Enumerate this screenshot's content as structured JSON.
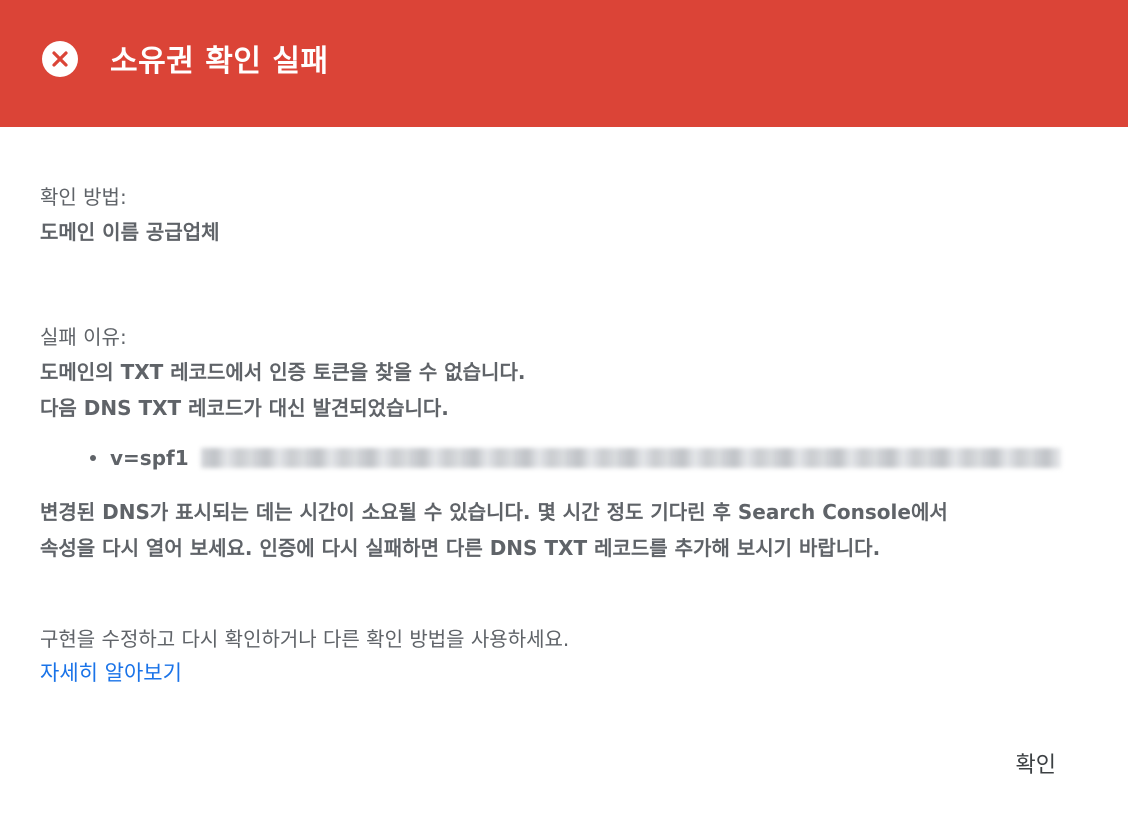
{
  "header": {
    "title": "소유권 확인 실패",
    "icon": "error-circle-icon",
    "background_color": "#db4437"
  },
  "verification_method": {
    "label": "확인 방법:",
    "value": "도메인 이름 공급업체"
  },
  "failure_reason": {
    "label": "실패 이유:",
    "line1": "도메인의 TXT 레코드에서 인증 토큰을 찾을 수 없습니다.",
    "line2": "다음 DNS TXT 레코드가 대신 발견되었습니다.",
    "records": [
      {
        "value": "v=spf1"
      }
    ]
  },
  "notice": {
    "line1": "변경된 DNS가 표시되는 데는 시간이 소요될 수 있습니다. 몇 시간 정도 기다린 후 Search Console에서",
    "line2": "속성을 다시 열어 보세요. 인증에 다시 실패하면 다른 DNS TXT 레코드를 추가해 보시기 바랍니다."
  },
  "help": {
    "text": "구현을 수정하고 다시 확인하거나 다른 확인 방법을 사용하세요.",
    "link_label": "자세히 알아보기",
    "link_color": "#1a73e8"
  },
  "actions": {
    "ok_label": "확인"
  }
}
